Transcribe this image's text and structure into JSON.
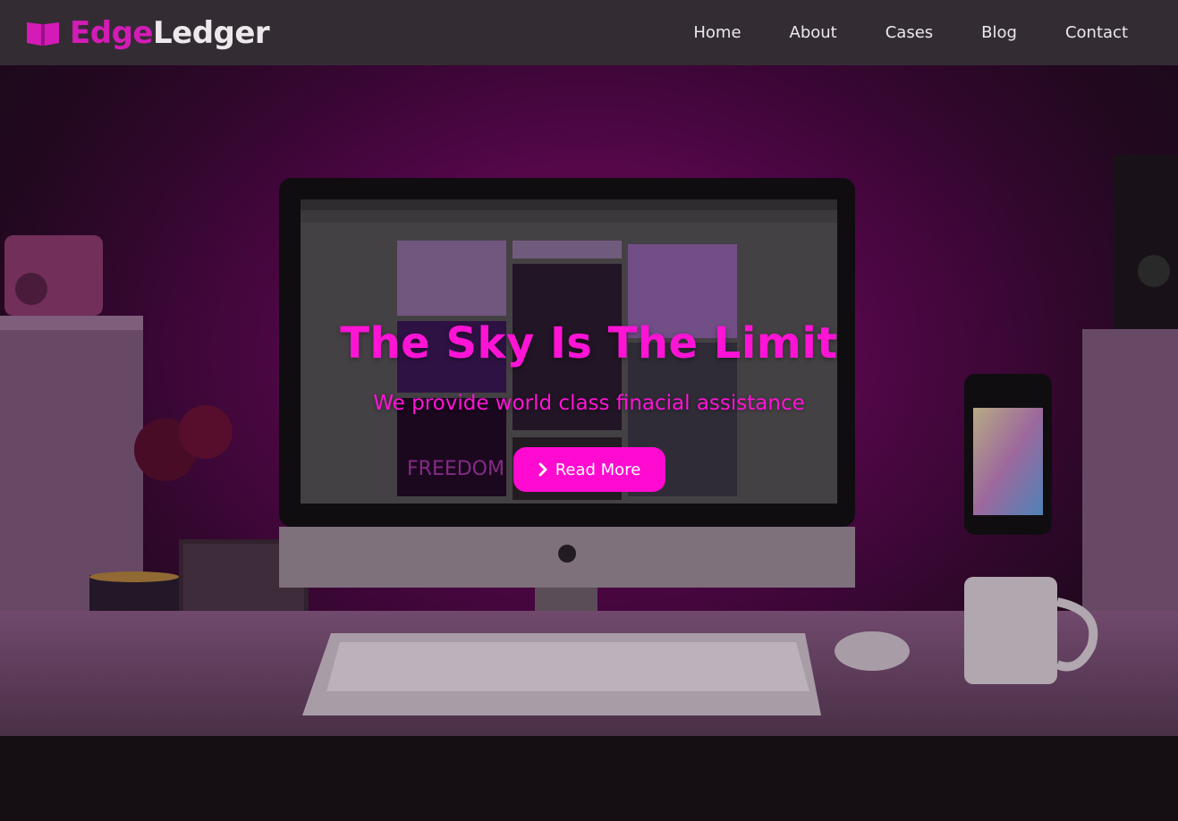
{
  "brand": {
    "name_part1": "Edge",
    "name_part2": "Ledger"
  },
  "nav": {
    "items": [
      {
        "label": "Home"
      },
      {
        "label": "About"
      },
      {
        "label": "Cases"
      },
      {
        "label": "Blog"
      },
      {
        "label": "Contact"
      }
    ]
  },
  "hero": {
    "title": "The Sky Is The Limit",
    "subtitle": "We provide world class finacial assistance",
    "cta_label": "Read More",
    "cta_icon": "chevron-right-icon"
  },
  "image_text": {
    "screen_word": "FREEDOM"
  },
  "colors": {
    "accent": "#ff14d6",
    "brand_accent": "#d41bb7",
    "navbar_bg": "#332d33",
    "button_bg": "#ff0ad0",
    "nav_text": "#ece8ec"
  }
}
